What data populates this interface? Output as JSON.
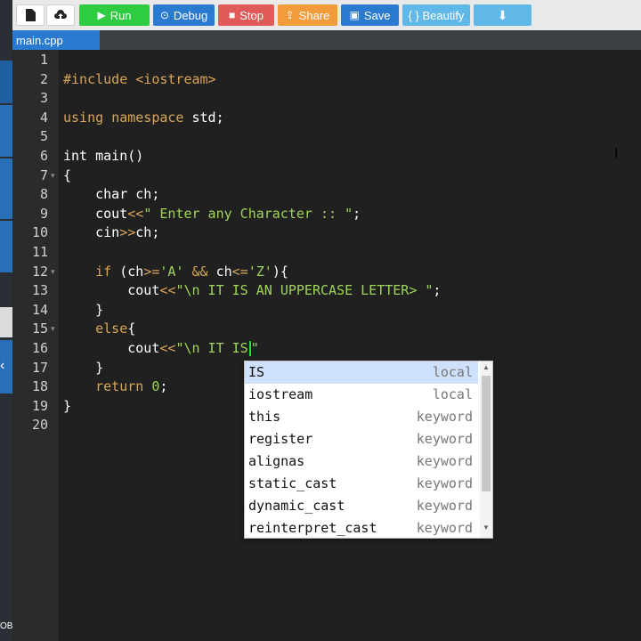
{
  "toolbar": {
    "run_label": "Run",
    "debug_label": "Debug",
    "stop_label": "Stop",
    "share_label": "Share",
    "save_label": "Save",
    "beautify_label": "{ } Beautify",
    "colors": {
      "run": "#2ecc40",
      "debug": "#2a7bd0",
      "stop": "#e05a5a",
      "share": "#f39c3c",
      "save": "#2a7bd0",
      "beautify": "#5fb8e8",
      "download": "#5fb8e8"
    }
  },
  "tabs": [
    {
      "label": "main.cpp"
    }
  ],
  "sidebar": {
    "bottom_label": "OB"
  },
  "editor": {
    "line_numbers": [
      "1",
      "2",
      "3",
      "4",
      "5",
      "6",
      "7",
      "8",
      "9",
      "10",
      "11",
      "12",
      "13",
      "14",
      "15",
      "16",
      "17",
      "18",
      "19",
      "20"
    ],
    "fold_lines": [
      7,
      12,
      15
    ],
    "lines": [
      [],
      [
        [
          "pre",
          "#include "
        ],
        [
          "pre",
          "<iostream>"
        ]
      ],
      [],
      [
        [
          "k",
          "using "
        ],
        [
          "k",
          "namespace "
        ],
        [
          "t",
          "std;"
        ]
      ],
      [],
      [
        [
          "t",
          "int main()"
        ]
      ],
      [
        [
          "t",
          "{"
        ]
      ],
      [
        [
          "t",
          "    char ch;"
        ]
      ],
      [
        [
          "t",
          "    cout"
        ],
        [
          "k",
          "<<"
        ],
        [
          "s",
          "\" Enter any Character :: \""
        ],
        [
          "t",
          ";"
        ]
      ],
      [
        [
          "t",
          "    cin"
        ],
        [
          "k",
          ">>"
        ],
        [
          "t",
          "ch;"
        ]
      ],
      [],
      [
        [
          "k",
          "    if "
        ],
        [
          "t",
          "(ch"
        ],
        [
          "k",
          ">="
        ],
        [
          "s",
          "'A'"
        ],
        [
          "t",
          " "
        ],
        [
          "k",
          "&&"
        ],
        [
          "t",
          " ch"
        ],
        [
          "k",
          "<="
        ],
        [
          "s",
          "'Z'"
        ],
        [
          "t",
          "){"
        ]
      ],
      [
        [
          "t",
          "        cout"
        ],
        [
          "k",
          "<<"
        ],
        [
          "s",
          "\"\\n IT IS AN UPPERCASE LETTER> \""
        ],
        [
          "t",
          ";"
        ]
      ],
      [
        [
          "t",
          "    }"
        ]
      ],
      [
        [
          "k",
          "    else"
        ],
        [
          "t",
          "{"
        ]
      ],
      [
        [
          "t",
          "        cout"
        ],
        [
          "k",
          "<<"
        ],
        [
          "s",
          "\"\\n IT IS\""
        ]
      ],
      [
        [
          "t",
          "    }"
        ]
      ],
      [
        [
          "k",
          "    return "
        ],
        [
          "s",
          "0"
        ],
        [
          "t",
          ";"
        ]
      ],
      [
        [
          "t",
          "}"
        ]
      ],
      []
    ]
  },
  "autocomplete": {
    "items": [
      {
        "name": "IS",
        "kind": "local"
      },
      {
        "name": "iostream",
        "kind": "local"
      },
      {
        "name": "this",
        "kind": "keyword"
      },
      {
        "name": "register",
        "kind": "keyword"
      },
      {
        "name": "alignas",
        "kind": "keyword"
      },
      {
        "name": "static_cast",
        "kind": "keyword"
      },
      {
        "name": "dynamic_cast",
        "kind": "keyword"
      },
      {
        "name": "reinterpret_cast",
        "kind": "keyword"
      }
    ],
    "selected_index": 0
  }
}
